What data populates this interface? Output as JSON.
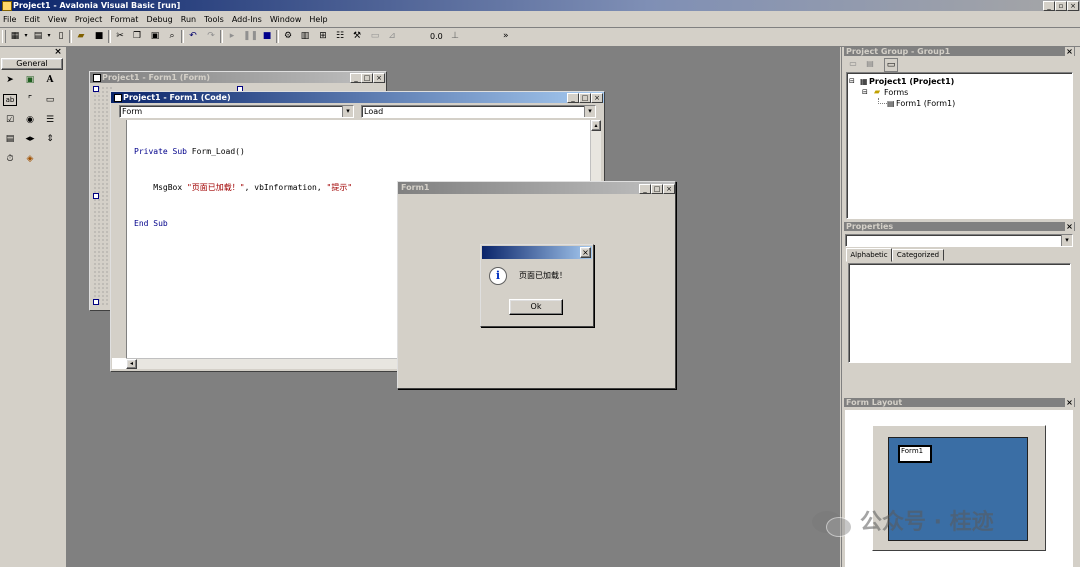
{
  "app": {
    "title": "Project1 - Avalonia Visual Basic [run]",
    "window_buttons": [
      "_",
      "▫",
      "×"
    ]
  },
  "menu": [
    "File",
    "Edit",
    "View",
    "Project",
    "Format",
    "Debug",
    "Run",
    "Tools",
    "Add-Ins",
    "Window",
    "Help"
  ],
  "toolbar": {
    "icons": [
      "add-project-icon",
      "add-form-icon",
      "menu-editor-icon",
      "open-icon",
      "save-icon",
      "cut-icon",
      "copy-icon",
      "paste-icon",
      "find-icon",
      "undo-icon",
      "redo-icon",
      "start-icon",
      "break-icon",
      "end-icon",
      "project-explorer-icon",
      "properties-icon",
      "form-layout-icon",
      "object-browser-icon",
      "toolbox-icon",
      "data-view-icon",
      "component-manager-icon"
    ],
    "position_text": "0.0",
    "overflow": "»"
  },
  "toolbox": {
    "title": "General",
    "close": "×",
    "tools": [
      "pointer",
      "picture-box",
      "label",
      "text-box",
      "frame",
      "command-button",
      "check-box",
      "option-button",
      "combo-box",
      "list-box",
      "hscrollbar",
      "vscrollbar",
      "timer",
      "drive-list"
    ]
  },
  "form_designer": {
    "title": "Project1 - Form1 (Form)"
  },
  "code_window": {
    "title": "Project1 - Form1 (Code)",
    "object_combo": "Form",
    "procedure_combo": "Load",
    "lines": [
      {
        "kw1": "Private Sub",
        "rest": " Form_Load()"
      },
      {
        "indent": "    ",
        "text": "MsgBox ",
        "str1": "\"页面已加载！\"",
        "mid": ", vbInformation, ",
        "str2": "\"提示\""
      },
      {
        "kw1": "End Sub",
        "rest": ""
      }
    ]
  },
  "running_form": {
    "title": "Form1",
    "msgbox": {
      "message": "页面已加载！",
      "button": "Ok",
      "close": "×"
    }
  },
  "project_group": {
    "title": "Project Group - Group1",
    "tree": {
      "project": "Project1 (Project1)",
      "folder": "Forms",
      "item": "Form1 (Form1)"
    }
  },
  "properties": {
    "title": "Properties",
    "tabs": [
      "Alphabetic",
      "Categorized"
    ]
  },
  "form_layout": {
    "title": "Form Layout",
    "form_label": "Form1"
  },
  "watermark": "公众号 · 桂迹",
  "colors": {
    "title_active": "#0a246a",
    "mdi_background": "#808080",
    "layout_screen": "#3a6ea5"
  }
}
